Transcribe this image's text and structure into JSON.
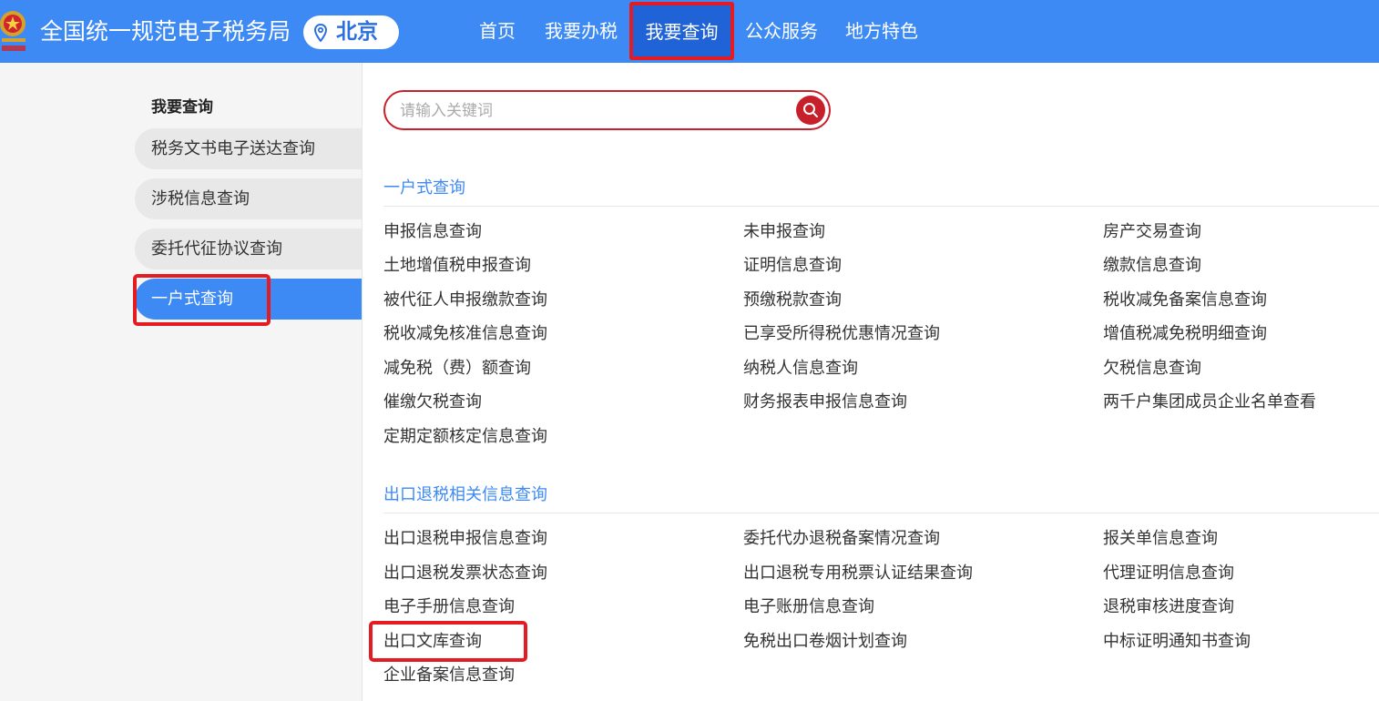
{
  "header": {
    "site_title": "全国统一规范电子税务局",
    "city": "北京",
    "nav": [
      "首页",
      "我要办税",
      "我要查询",
      "公众服务",
      "地方特色"
    ],
    "active_nav_index": 2,
    "bg_color": "#3d8af4"
  },
  "sidebar": {
    "title": "我要查询",
    "items": [
      "税务文书电子送达查询",
      "涉税信息查询",
      "委托代征协议查询",
      "一户式查询"
    ],
    "active_index": 3
  },
  "search": {
    "placeholder": "请输入关键词",
    "value": ""
  },
  "sections": [
    {
      "title": "一户式查询",
      "rows": [
        [
          "申报信息查询",
          "未申报查询",
          "房产交易查询"
        ],
        [
          "土地增值税申报查询",
          "证明信息查询",
          "缴款信息查询"
        ],
        [
          "被代征人申报缴款查询",
          "预缴税款查询",
          "税收减免备案信息查询"
        ],
        [
          "税收减免核准信息查询",
          "已享受所得税优惠情况查询",
          "增值税减免税明细查询"
        ],
        [
          "减免税（费）额查询",
          "纳税人信息查询",
          "欠税信息查询"
        ],
        [
          "催缴欠税查询",
          "财务报表申报信息查询",
          "两千户集团成员企业名单查看"
        ],
        [
          "定期定额核定信息查询"
        ]
      ]
    },
    {
      "title": "出口退税相关信息查询",
      "rows": [
        [
          "出口退税申报信息查询",
          "委托代办退税备案情况查询",
          "报关单信息查询"
        ],
        [
          "出口退税发票状态查询",
          "出口退税专用税票认证结果查询",
          "代理证明信息查询"
        ],
        [
          "电子手册信息查询",
          "电子账册信息查询",
          "退税审核进度查询"
        ],
        [
          "出口文库查询",
          "免税出口卷烟计划查询",
          "中标证明通知书查询"
        ],
        [
          "企业备案信息查询"
        ]
      ]
    }
  ],
  "highlight_color": "#e41b23"
}
